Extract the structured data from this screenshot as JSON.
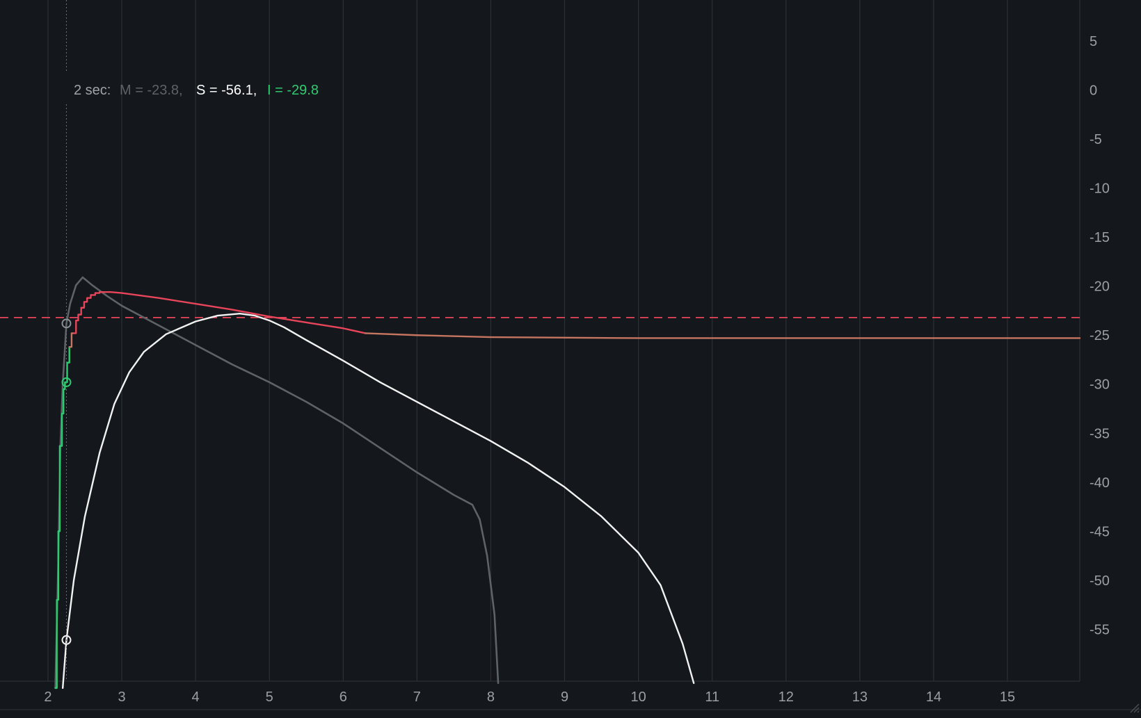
{
  "chart_data": {
    "type": "line",
    "xlim": [
      1.35,
      15.98
    ],
    "ylim": [
      -60.3,
      9.2
    ],
    "x_ticks": [
      2,
      3,
      4,
      5,
      6,
      7,
      8,
      9,
      10,
      11,
      12,
      13,
      14,
      15
    ],
    "y_ticks": [
      5,
      0,
      -5,
      -10,
      -15,
      -20,
      -25,
      -30,
      -35,
      -40,
      -45,
      -50,
      -55
    ],
    "grid": "vertical",
    "target_line": {
      "y": -23.2,
      "color": "#e8455b",
      "style": "dashed"
    },
    "cursor": {
      "x": 2.25,
      "label": "2 sec:",
      "m_text": "M = -23.8,",
      "s_text": "S = -56.1,",
      "i_text": "I = -29.8",
      "markers": {
        "M": -23.8,
        "I": -29.8,
        "S": -56.1
      }
    },
    "series": [
      {
        "key": "M",
        "color": "#5d6367",
        "points": [
          [
            2.1,
            -61
          ],
          [
            2.14,
            -48
          ],
          [
            2.17,
            -36
          ],
          [
            2.2,
            -30
          ],
          [
            2.25,
            -23.8
          ],
          [
            2.3,
            -21.8
          ],
          [
            2.38,
            -19.9
          ],
          [
            2.47,
            -19.1
          ],
          [
            2.6,
            -19.9
          ],
          [
            2.8,
            -21.0
          ],
          [
            3.0,
            -22.0
          ],
          [
            3.5,
            -24.0
          ],
          [
            4.0,
            -26.0
          ],
          [
            4.5,
            -28.0
          ],
          [
            5.0,
            -29.8
          ],
          [
            5.5,
            -31.8
          ],
          [
            6.0,
            -34.0
          ],
          [
            6.5,
            -36.5
          ],
          [
            7.0,
            -39.0
          ],
          [
            7.5,
            -41.3
          ],
          [
            7.75,
            -42.3
          ],
          [
            7.85,
            -43.8
          ],
          [
            7.95,
            -47.5
          ],
          [
            8.05,
            -53.5
          ],
          [
            8.1,
            -60.5
          ]
        ]
      },
      {
        "key": "S",
        "color": "#f2f2f2",
        "points": [
          [
            2.2,
            -61
          ],
          [
            2.25,
            -56.1
          ],
          [
            2.35,
            -50
          ],
          [
            2.5,
            -43.5
          ],
          [
            2.7,
            -37
          ],
          [
            2.9,
            -32
          ],
          [
            3.1,
            -28.8
          ],
          [
            3.3,
            -26.7
          ],
          [
            3.6,
            -24.9
          ],
          [
            4.0,
            -23.6
          ],
          [
            4.3,
            -23.0
          ],
          [
            4.6,
            -22.8
          ],
          [
            4.8,
            -23.0
          ],
          [
            5.0,
            -23.5
          ],
          [
            5.2,
            -24.2
          ],
          [
            5.5,
            -25.5
          ],
          [
            6.0,
            -27.6
          ],
          [
            6.5,
            -29.8
          ],
          [
            7.0,
            -31.8
          ],
          [
            7.5,
            -33.8
          ],
          [
            8.0,
            -35.8
          ],
          [
            8.5,
            -38.0
          ],
          [
            9.0,
            -40.5
          ],
          [
            9.5,
            -43.5
          ],
          [
            10.0,
            -47.2
          ],
          [
            10.3,
            -50.5
          ],
          [
            10.6,
            -56.5
          ],
          [
            10.75,
            -60.5
          ]
        ]
      },
      {
        "key": "I",
        "color": "#2ecc71",
        "step": true,
        "points": [
          [
            2.1,
            -61
          ],
          [
            2.12,
            -61
          ],
          [
            2.12,
            -52
          ],
          [
            2.14,
            -52
          ],
          [
            2.14,
            -45
          ],
          [
            2.16,
            -45
          ],
          [
            2.16,
            -36.3
          ],
          [
            2.19,
            -36.3
          ],
          [
            2.19,
            -33
          ],
          [
            2.21,
            -33
          ],
          [
            2.21,
            -30.5
          ],
          [
            2.23,
            -30.5
          ],
          [
            2.23,
            -29.8
          ],
          [
            2.26,
            -29.8
          ],
          [
            2.26,
            -27.8
          ],
          [
            2.29,
            -27.8
          ],
          [
            2.29,
            -26.2
          ]
        ]
      },
      {
        "key": "I-avg",
        "color": "#c57560",
        "step": true,
        "points": [
          [
            2.29,
            -26.2
          ],
          [
            2.32,
            -26.2
          ],
          [
            2.32,
            -24.8
          ],
          [
            2.35,
            -24.8
          ]
        ]
      },
      {
        "key": "LRA",
        "color": "#e8455b",
        "step": true,
        "points": [
          [
            2.35,
            -24.8
          ],
          [
            2.38,
            -24.8
          ],
          [
            2.38,
            -23.5
          ],
          [
            2.41,
            -23.5
          ],
          [
            2.41,
            -22.9
          ],
          [
            2.45,
            -22.9
          ],
          [
            2.45,
            -22.2
          ],
          [
            2.49,
            -22.2
          ],
          [
            2.49,
            -21.6
          ],
          [
            2.53,
            -21.6
          ],
          [
            2.53,
            -21.2
          ],
          [
            2.58,
            -21.2
          ],
          [
            2.58,
            -20.9
          ],
          [
            2.64,
            -20.9
          ],
          [
            2.64,
            -20.7
          ],
          [
            2.7,
            -20.7
          ]
        ]
      },
      {
        "key": "LRA-curve",
        "color": "#e8455b",
        "points": [
          [
            2.7,
            -20.6
          ],
          [
            2.85,
            -20.6
          ],
          [
            3.0,
            -20.7
          ],
          [
            3.5,
            -21.2
          ],
          [
            4.0,
            -21.8
          ],
          [
            4.5,
            -22.4
          ],
          [
            5.0,
            -23.1
          ],
          [
            5.5,
            -23.7
          ],
          [
            6.0,
            -24.3
          ],
          [
            6.3,
            -24.8
          ]
        ]
      },
      {
        "key": "I-final",
        "color": "#c57560",
        "points": [
          [
            6.3,
            -24.8
          ],
          [
            7.0,
            -25.0
          ],
          [
            8.0,
            -25.2
          ],
          [
            10.0,
            -25.3
          ],
          [
            12.0,
            -25.3
          ],
          [
            14.0,
            -25.3
          ],
          [
            15.98,
            -25.3
          ]
        ]
      }
    ]
  }
}
